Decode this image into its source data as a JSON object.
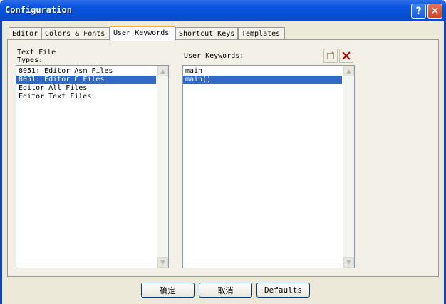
{
  "window": {
    "title": "Configuration"
  },
  "tabs": [
    {
      "label": "Editor"
    },
    {
      "label": "Colors & Fonts"
    },
    {
      "label": "User Keywords"
    },
    {
      "label": "Shortcut Keys"
    },
    {
      "label": "Templates"
    }
  ],
  "active_tab": "User Keywords",
  "left_list": {
    "label": "Text File Types:",
    "items": [
      {
        "label": "8051: Editor Asm Files"
      },
      {
        "label": "8051: Editor C Files",
        "selected": true
      },
      {
        "label": "Editor All Files"
      },
      {
        "label": "Editor Text Files"
      }
    ]
  },
  "right_list": {
    "label": "User Keywords:",
    "items": [
      {
        "label": "main"
      },
      {
        "label": "main()",
        "selected": true
      }
    ],
    "new_icon": "new-item-icon",
    "delete_icon": "delete-icon"
  },
  "buttons": {
    "ok": "确定",
    "cancel": "取消",
    "defaults": "Defaults"
  }
}
